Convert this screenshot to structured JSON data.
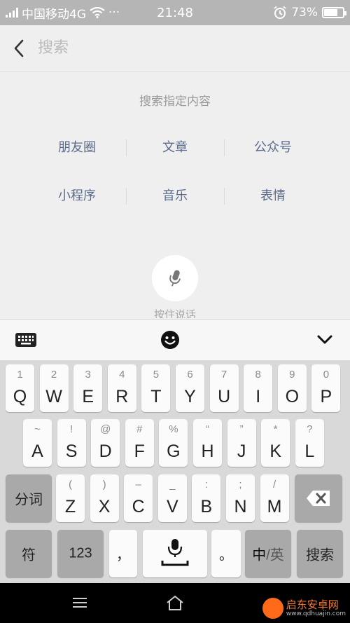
{
  "statusbar": {
    "carrier": "中国移动4G",
    "dots": "···",
    "time": "21:48",
    "battery": "73%",
    "battery_level": 0.73
  },
  "search": {
    "placeholder": "搜索"
  },
  "hint": "搜索指定内容",
  "categories_row1": [
    "朋友圈",
    "文章",
    "公众号"
  ],
  "categories_row2": [
    "小程序",
    "音乐",
    "表情"
  ],
  "voice_label": "按住说话",
  "keyboard": {
    "row1": [
      {
        "top": "1",
        "main": "Q"
      },
      {
        "top": "2",
        "main": "W"
      },
      {
        "top": "3",
        "main": "E"
      },
      {
        "top": "4",
        "main": "R"
      },
      {
        "top": "5",
        "main": "T"
      },
      {
        "top": "6",
        "main": "Y"
      },
      {
        "top": "7",
        "main": "U"
      },
      {
        "top": "8",
        "main": "I"
      },
      {
        "top": "9",
        "main": "O"
      },
      {
        "top": "0",
        "main": "P"
      }
    ],
    "row2": [
      {
        "top": "~",
        "main": "A"
      },
      {
        "top": "!",
        "main": "S"
      },
      {
        "top": "@",
        "main": "D"
      },
      {
        "top": "#",
        "main": "F"
      },
      {
        "top": "%",
        "main": "G"
      },
      {
        "top": "“",
        "main": "H"
      },
      {
        "top": "”",
        "main": "J"
      },
      {
        "top": "*",
        "main": "K"
      },
      {
        "top": "?",
        "main": "L"
      }
    ],
    "row3": [
      {
        "top": "(",
        "main": "Z"
      },
      {
        "top": ")",
        "main": "X"
      },
      {
        "top": "–",
        "main": "C"
      },
      {
        "top": "_",
        "main": "V"
      },
      {
        "top": ":",
        "main": "B"
      },
      {
        "top": ";",
        "main": "N"
      },
      {
        "top": "/",
        "main": "M"
      }
    ],
    "segment_label": "分词",
    "symbol_label": "符",
    "numbers_label": "123",
    "comma_label": "，",
    "period_label": "。",
    "lang_cn": "中",
    "lang_en": "/英",
    "search_label": "搜索"
  },
  "watermark": {
    "title": "启东安卓网",
    "url": "www.qdhuajin.com"
  }
}
